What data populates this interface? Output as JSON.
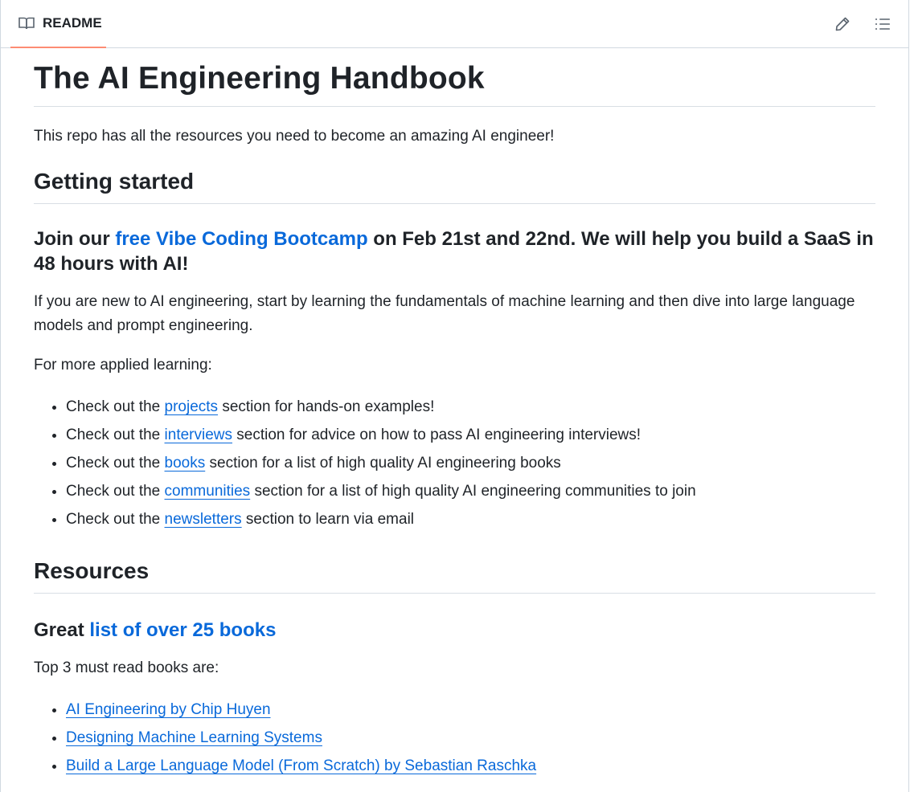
{
  "tab": {
    "label": "README",
    "icon": "book-icon"
  },
  "actions": {
    "edit_icon": "pencil-icon",
    "outline_icon": "list-icon"
  },
  "colors": {
    "link": "#0969da",
    "tab_underline": "#fd8c73",
    "text": "#1f2328",
    "border": "#d1d9e0"
  },
  "title": "The AI Engineering Handbook",
  "intro": "This repo has all the resources you need to become an amazing AI engineer!",
  "getting_started": {
    "heading": "Getting started",
    "bootcamp": {
      "prefix": "Join our ",
      "link": "free Vibe Coding Bootcamp",
      "suffix": " on Feb 21st and 22nd. We will help you build a SaaS in 48 hours with AI!"
    },
    "para": "If you are new to AI engineering, start by learning the fundamentals of machine learning and then dive into large language models and prompt engineering.",
    "applied_label": "For more applied learning:",
    "items": [
      {
        "prefix": "Check out the ",
        "link": "projects",
        "suffix": " section for hands-on examples!"
      },
      {
        "prefix": "Check out the ",
        "link": "interviews",
        "suffix": " section for advice on how to pass AI engineering interviews!"
      },
      {
        "prefix": "Check out the ",
        "link": "books",
        "suffix": " section for a list of high quality AI engineering books"
      },
      {
        "prefix": "Check out the ",
        "link": "communities",
        "suffix": " section for a list of high quality AI engineering communities to join"
      },
      {
        "prefix": "Check out the ",
        "link": "newsletters",
        "suffix": " section to learn via email"
      }
    ]
  },
  "resources": {
    "heading": "Resources",
    "books_heading": {
      "prefix": "Great ",
      "link": "list of over 25 books"
    },
    "top3_label": "Top 3 must read books are:",
    "books": [
      "AI Engineering by Chip Huyen",
      "Designing Machine Learning Systems",
      "Build a Large Language Model (From Scratch) by Sebastian Raschka"
    ]
  }
}
